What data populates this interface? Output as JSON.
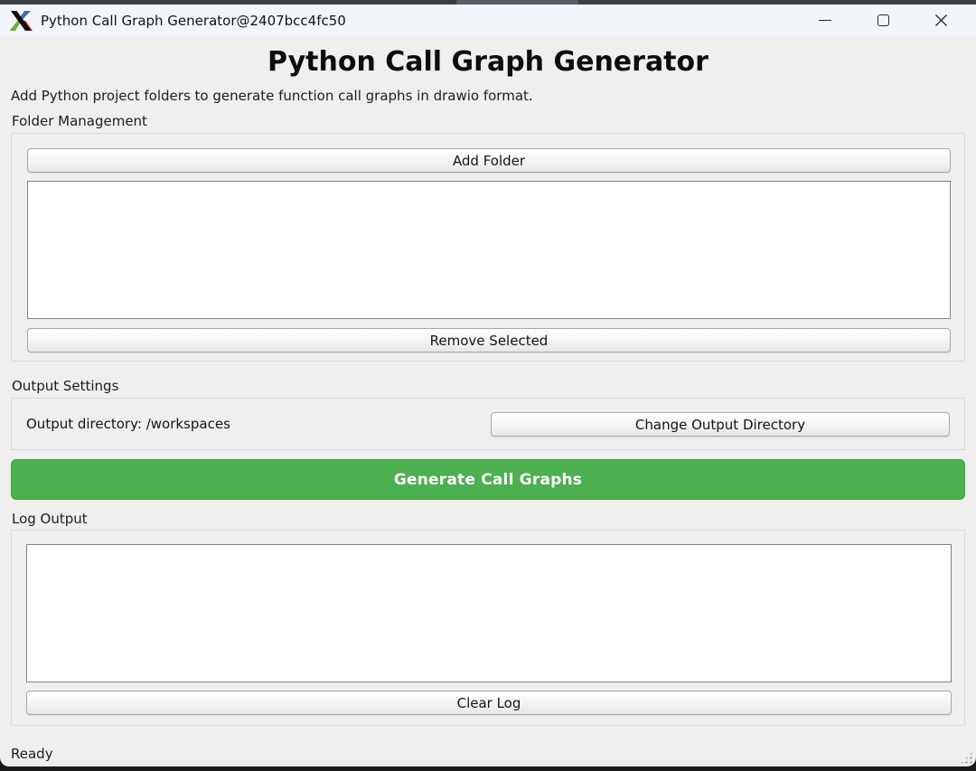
{
  "window": {
    "title": "Python Call Graph Generator@2407bcc4fc50"
  },
  "header": {
    "title": "Python Call Graph Generator",
    "subtitle": "Add Python project folders to generate function call graphs in drawio format."
  },
  "sections": {
    "folder_management": {
      "label": "Folder Management",
      "add_folder_button": "Add Folder",
      "remove_selected_button": "Remove Selected",
      "folders": []
    },
    "output_settings": {
      "label": "Output Settings",
      "output_directory_text": "Output directory: /workspaces",
      "change_directory_button": "Change Output Directory"
    },
    "generate": {
      "button_label": "Generate Call Graphs"
    },
    "log_output": {
      "label": "Log Output",
      "content": "",
      "clear_button": "Clear Log"
    }
  },
  "status_bar": {
    "text": "Ready"
  },
  "icons": {
    "app": "xorg-logo-icon",
    "minimize": "minimize-icon",
    "maximize": "maximize-icon",
    "close": "close-icon",
    "resize_grip": "resize-grip-icon"
  },
  "colors": {
    "generate_button_green": "#4caf50",
    "titlebar_background": "#f2f5f9",
    "content_background": "#efefed",
    "background_strip": "#3a4046"
  }
}
